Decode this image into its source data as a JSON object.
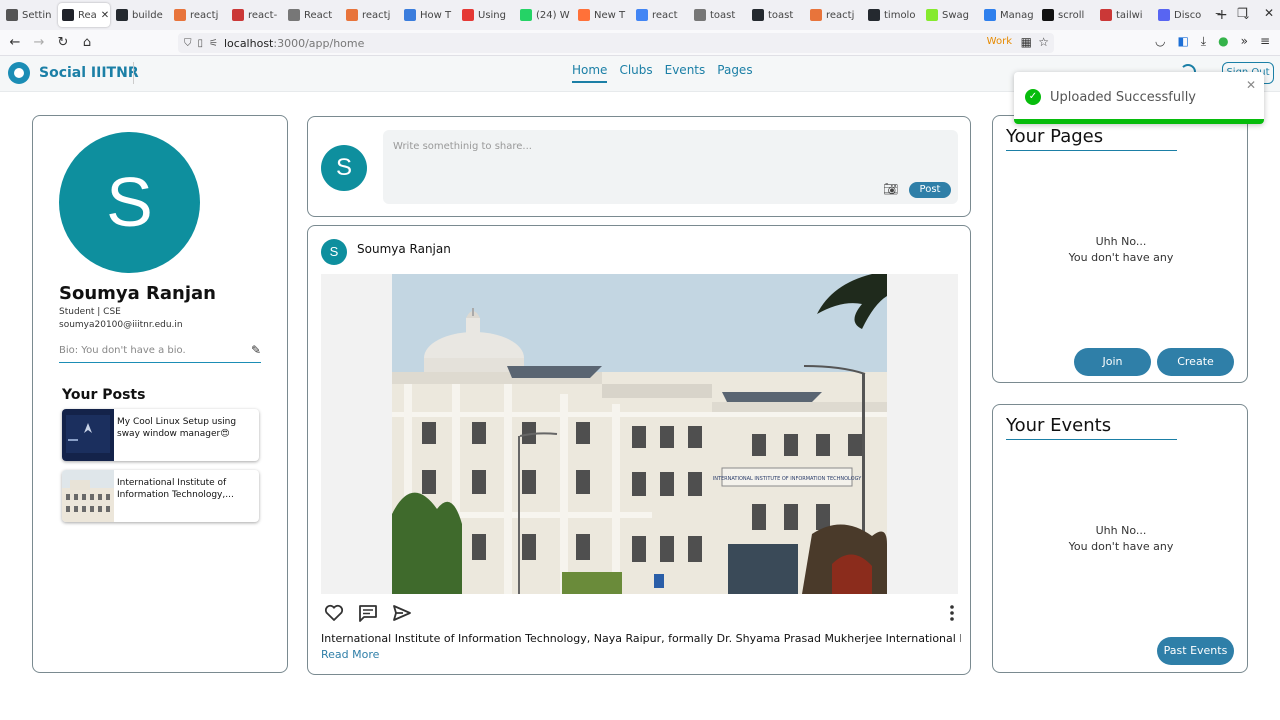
{
  "browser": {
    "tabs": [
      {
        "label": "Settin",
        "icon": "gear-icon",
        "color": "#555555"
      },
      {
        "label": "Rea",
        "icon": "react-icon",
        "color": "#20232a",
        "active": true
      },
      {
        "label": "builde",
        "icon": "github-icon",
        "color": "#24292f"
      },
      {
        "label": "reactj",
        "icon": "pencil-icon",
        "color": "#e8743b"
      },
      {
        "label": "react-",
        "icon": "npm-icon",
        "color": "#cb3837"
      },
      {
        "label": "React",
        "icon": "stack-icon",
        "color": "#777777"
      },
      {
        "label": "reactj",
        "icon": "pencil-icon",
        "color": "#e8743b"
      },
      {
        "label": "How T",
        "icon": "help-icon",
        "color": "#3b7ddd"
      },
      {
        "label": "Using",
        "icon": "play-icon",
        "color": "#e53935"
      },
      {
        "label": "(24) W",
        "icon": "chat-icon",
        "color": "#25d366"
      },
      {
        "label": "New T",
        "icon": "firefox-icon",
        "color": "#ff7139"
      },
      {
        "label": "react",
        "icon": "google-icon",
        "color": "#4285f4"
      },
      {
        "label": "toast",
        "icon": "stack-icon",
        "color": "#777777"
      },
      {
        "label": "toast",
        "icon": "github-icon",
        "color": "#24292f"
      },
      {
        "label": "reactj",
        "icon": "pencil-icon",
        "color": "#e8743b"
      },
      {
        "label": "timolo",
        "icon": "github-icon",
        "color": "#24292f"
      },
      {
        "label": "Swag",
        "icon": "swagger-icon",
        "color": "#85ea2d"
      },
      {
        "label": "Manag",
        "icon": "vscode-icon",
        "color": "#2f80ed"
      },
      {
        "label": "scroll",
        "icon": "bookmark-icon",
        "color": "#111111"
      },
      {
        "label": "tailwi",
        "icon": "npm-icon",
        "color": "#cb3837"
      },
      {
        "label": "Disco",
        "icon": "discord-icon",
        "color": "#5865f2"
      }
    ],
    "url_host": "localhost",
    "url_path": ":3000/app/home",
    "container_label": "Work"
  },
  "app": {
    "brand": "Social IIITNR",
    "nav": [
      {
        "label": "Home",
        "active": true
      },
      {
        "label": "Clubs"
      },
      {
        "label": "Events"
      },
      {
        "label": "Pages"
      }
    ],
    "signout_label": "Sign Out",
    "accent": "#1b7fa6"
  },
  "profile": {
    "initial": "S",
    "name": "Soumya Ranjan",
    "role": "Student | CSE",
    "email": "soumya20100@iiitnr.edu.in",
    "bio_placeholder": "Bio: You don't have a bio.",
    "posts_heading": "Your Posts",
    "posts": [
      {
        "title": "My Cool Linux Setup using sway window manager😍"
      },
      {
        "title": "International Institute of Information Technology,..."
      }
    ]
  },
  "composer": {
    "initial": "S",
    "placeholder": "Write somethinig to share...",
    "post_label": "Post"
  },
  "post": {
    "initial": "S",
    "author": "Soumya Ranjan",
    "building_sign": "INTERNATIONAL INSTITUTE OF INFORMATION TECHNOLOGY",
    "caption": "International Institute of Information Technology, Naya Raipur, formally Dr. Shyama Prasad Mukherjee International Insti...",
    "read_more": "Read More"
  },
  "pages_panel": {
    "title": "Your Pages",
    "empty_line1": "Uhh No...",
    "empty_line2": "You don't have any",
    "join_label": "Join",
    "create_label": "Create"
  },
  "events_panel": {
    "title": "Your Events",
    "empty_line1": "Uhh No...",
    "empty_line2": "You don't have any",
    "past_label": "Past Events"
  },
  "toast": {
    "message": "Uploaded Successfully",
    "color": "#07bc0c"
  }
}
